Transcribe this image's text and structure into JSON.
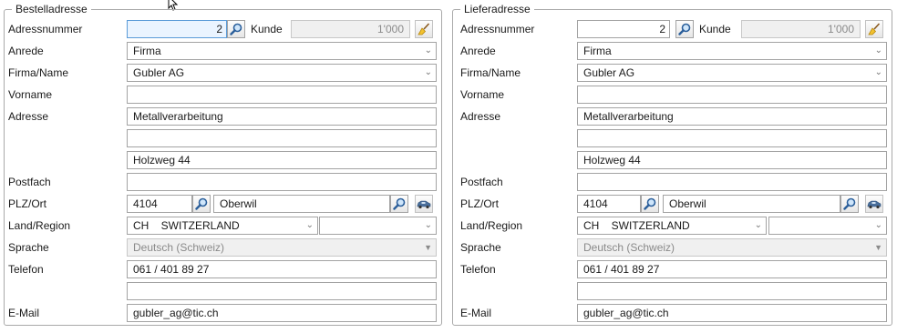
{
  "left": {
    "title": "Bestelladresse",
    "labels": {
      "number": "Adressnummer",
      "kunde": "Kunde",
      "anrede": "Anrede",
      "firma": "Firma/Name",
      "vorname": "Vorname",
      "adresse": "Adresse",
      "postfach": "Postfach",
      "plz_ort": "PLZ/Ort",
      "land": "Land/Region",
      "sprache": "Sprache",
      "telefon": "Telefon",
      "email": "E-Mail"
    },
    "number": "2",
    "kunde_value": "1'000",
    "anrede": "Firma",
    "firma": "Gubler AG",
    "vorname": "",
    "adresse1": "Metallverarbeitung",
    "adresse2": "",
    "adresse3": "Holzweg 44",
    "postfach": "",
    "plz": "4104",
    "ort": "Oberwil",
    "land": "CH    SWITZERLAND",
    "region": "",
    "sprache": "Deutsch (Schweiz)",
    "telefon": "061 / 401 89 27",
    "telefon2": "",
    "email": "gubler_ag@tic.ch"
  },
  "right": {
    "title": "Lieferadresse",
    "labels": {
      "number": "Adressnummer",
      "kunde": "Kunde",
      "anrede": "Anrede",
      "firma": "Firma/Name",
      "vorname": "Vorname",
      "adresse": "Adresse",
      "postfach": "Postfach",
      "plz_ort": "PLZ/Ort",
      "land": "Land/Region",
      "sprache": "Sprache",
      "telefon": "Telefon",
      "email": "E-Mail"
    },
    "number": "2",
    "kunde_value": "1'000",
    "anrede": "Firma",
    "firma": "Gubler AG",
    "vorname": "",
    "adresse1": "Metallverarbeitung",
    "adresse2": "",
    "adresse3": "Holzweg 44",
    "postfach": "",
    "plz": "4104",
    "ort": "Oberwil",
    "land": "CH    SWITZERLAND",
    "region": "",
    "sprache": "Deutsch (Schweiz)",
    "telefon": "061 / 401 89 27",
    "telefon2": "",
    "email": "gubler_ag@tic.ch"
  },
  "icons": {
    "search": "magnifier-icon",
    "clear": "broom-icon",
    "map": "car-icon",
    "cursor": "mouse-pointer-icon"
  },
  "colors": {
    "focus_bg": "#eaf4ff",
    "border": "#a3a3a3",
    "readonly_bg": "#f0f0f0"
  }
}
